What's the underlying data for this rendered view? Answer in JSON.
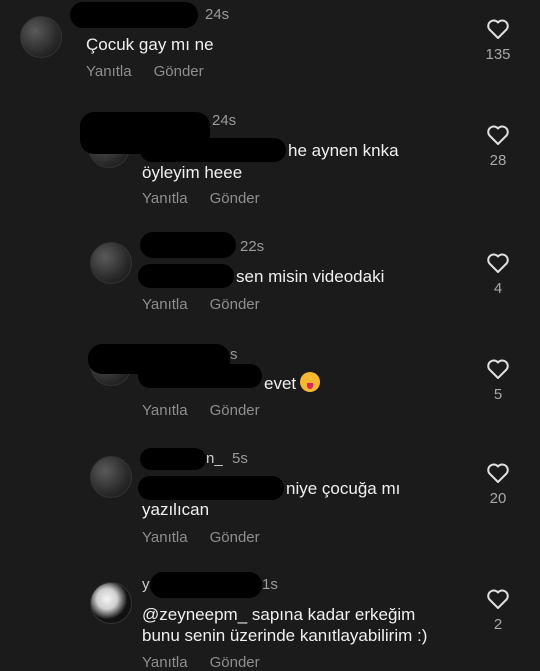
{
  "comments": [
    {
      "time": "24s",
      "text": "Çocuk gay mı ne",
      "reply": "Yanıtla",
      "send": "Gönder",
      "likes": "135"
    },
    {
      "time": "24s",
      "text_line1": "he aynen knka",
      "text_line2": "öyleyim heee",
      "reply": "Yanıtla",
      "send": "Gönder",
      "likes": "28"
    },
    {
      "time": "22s",
      "text": "sen misin videodaki",
      "reply": "Yanıtla",
      "send": "Gönder",
      "likes": "4"
    },
    {
      "time": "s",
      "text": "evet",
      "emoji": "tongue-wink-emoji",
      "reply": "Yanıtla",
      "send": "Gönder",
      "likes": "5"
    },
    {
      "time": "5s",
      "name_tail": "n_",
      "text_line1": "niye çocuğa mı",
      "text_line2": "yazılıcan",
      "reply": "Yanıtla",
      "send": "Gönder",
      "likes": "20"
    },
    {
      "time": "1s",
      "name_head": "y",
      "text_line1": "@zeyneepm_ sapına kadar erkeğim",
      "text_line2": "bunu senin üzerinde kanıtlayabilirim :)",
      "reply": "Yanıtla",
      "send": "Gönder",
      "likes": "2"
    }
  ],
  "icons": {
    "like": "heart-outline-icon"
  },
  "colors": {
    "background": "#1b1b1b",
    "text": "#f0f0f0",
    "muted": "#8e8e8e"
  }
}
